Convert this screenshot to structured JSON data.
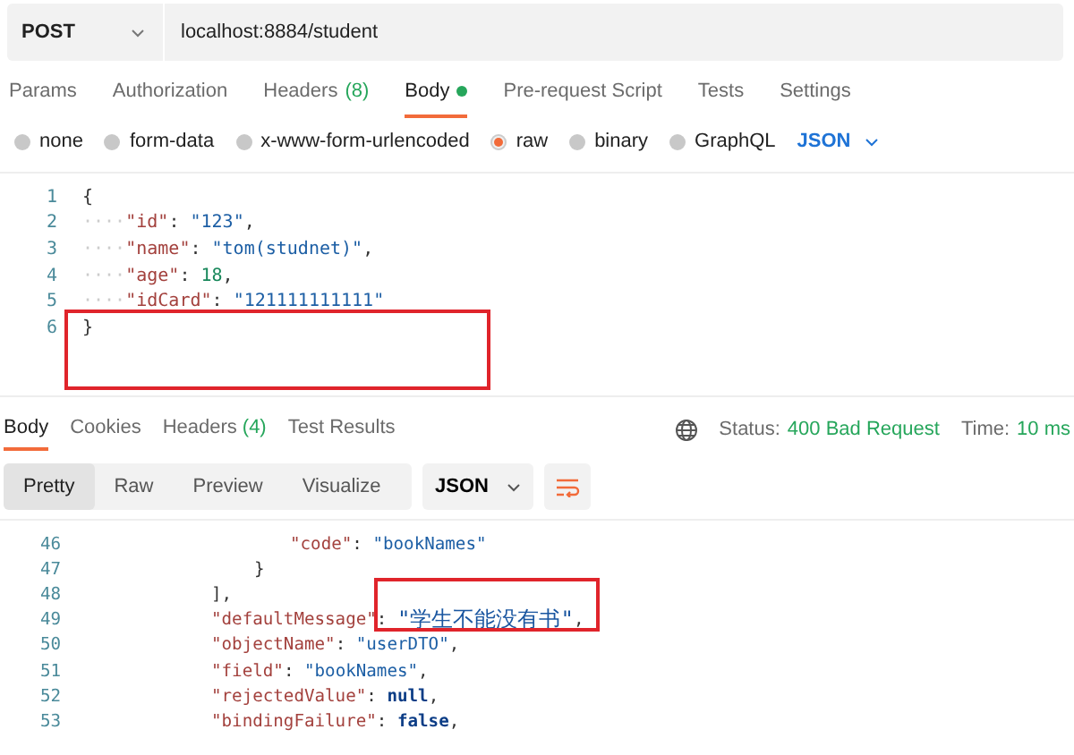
{
  "request": {
    "method": "POST",
    "url": "localhost:8884/student"
  },
  "request_tabs": [
    {
      "label": "Params",
      "selected": false,
      "dot": false
    },
    {
      "label": "Authorization",
      "selected": false,
      "dot": false
    },
    {
      "label": "Headers",
      "count": "(8)",
      "selected": false,
      "dot": false
    },
    {
      "label": "Body",
      "selected": true,
      "dot": true
    },
    {
      "label": "Pre-request Script",
      "selected": false,
      "dot": false
    },
    {
      "label": "Tests",
      "selected": false,
      "dot": false
    },
    {
      "label": "Settings",
      "selected": false,
      "dot": false
    }
  ],
  "body_types": [
    {
      "label": "none",
      "selected": false
    },
    {
      "label": "form-data",
      "selected": false
    },
    {
      "label": "x-www-form-urlencoded",
      "selected": false
    },
    {
      "label": "raw",
      "selected": true
    },
    {
      "label": "binary",
      "selected": false
    },
    {
      "label": "GraphQL",
      "selected": false
    }
  ],
  "body_format": "JSON",
  "request_body": [
    {
      "number": "1",
      "tokens": [
        {
          "kind": "punct",
          "text": "{"
        }
      ]
    },
    {
      "number": "2",
      "tokens": [
        {
          "kind": "ws",
          "text": "····"
        },
        {
          "kind": "key",
          "text": "\"id\""
        },
        {
          "kind": "punct",
          "text": ": "
        },
        {
          "kind": "str",
          "text": "\"123\""
        },
        {
          "kind": "punct",
          "text": ","
        }
      ]
    },
    {
      "number": "3",
      "tokens": [
        {
          "kind": "ws",
          "text": "····"
        },
        {
          "kind": "key",
          "text": "\"name\""
        },
        {
          "kind": "punct",
          "text": ": "
        },
        {
          "kind": "str",
          "text": "\"tom(studnet)\""
        },
        {
          "kind": "punct",
          "text": ","
        }
      ]
    },
    {
      "number": "4",
      "tokens": [
        {
          "kind": "ws",
          "text": "····"
        },
        {
          "kind": "key",
          "text": "\"age\""
        },
        {
          "kind": "punct",
          "text": ": "
        },
        {
          "kind": "num",
          "text": "18"
        },
        {
          "kind": "punct",
          "text": ","
        }
      ]
    },
    {
      "number": "5",
      "tokens": [
        {
          "kind": "ws",
          "text": "····"
        },
        {
          "kind": "key",
          "text": "\"idCard\""
        },
        {
          "kind": "punct",
          "text": ": "
        },
        {
          "kind": "str",
          "text": "\"121111111111\""
        }
      ]
    },
    {
      "number": "6",
      "tokens": [
        {
          "kind": "punct",
          "text": "}"
        }
      ]
    }
  ],
  "response_tabs": [
    {
      "label": "Body",
      "selected": true
    },
    {
      "label": "Cookies",
      "selected": false
    },
    {
      "label": "Headers",
      "count": "(4)",
      "selected": false
    },
    {
      "label": "Test Results",
      "selected": false
    }
  ],
  "status": {
    "label": "Status:",
    "value": "400 Bad Request"
  },
  "time": {
    "label": "Time:",
    "value": "10 ms"
  },
  "view_modes": [
    {
      "label": "Pretty",
      "selected": true
    },
    {
      "label": "Raw",
      "selected": false
    },
    {
      "label": "Preview",
      "selected": false
    },
    {
      "label": "Visualize",
      "selected": false
    }
  ],
  "response_format": "JSON",
  "response_body": [
    {
      "number": "46",
      "kind": "deep",
      "tokens": [
        {
          "kind": "key",
          "text": "\"code\""
        },
        {
          "kind": "punct",
          "text": ": "
        },
        {
          "kind": "str",
          "text": "\"bookNames\""
        }
      ]
    },
    {
      "number": "47",
      "kind": "inner",
      "tokens": [
        {
          "kind": "punct",
          "text": "}"
        }
      ]
    },
    {
      "number": "48",
      "kind": "outer",
      "tokens": [
        {
          "kind": "punct",
          "text": "],"
        }
      ]
    },
    {
      "number": "49",
      "kind": "outer",
      "tokens": [
        {
          "kind": "key",
          "text": "\"defaultMessage\""
        },
        {
          "kind": "punct",
          "text": ": "
        },
        {
          "kind": "str",
          "text": "\"学生不能没有书\""
        },
        {
          "kind": "punct",
          "text": ","
        }
      ]
    },
    {
      "number": "50",
      "kind": "outer",
      "tokens": [
        {
          "kind": "key",
          "text": "\"objectName\""
        },
        {
          "kind": "punct",
          "text": ": "
        },
        {
          "kind": "str",
          "text": "\"userDTO\""
        },
        {
          "kind": "punct",
          "text": ","
        }
      ]
    },
    {
      "number": "51",
      "kind": "outer",
      "tokens": [
        {
          "kind": "key",
          "text": "\"field\""
        },
        {
          "kind": "punct",
          "text": ": "
        },
        {
          "kind": "str",
          "text": "\"bookNames\""
        },
        {
          "kind": "punct",
          "text": ","
        }
      ]
    },
    {
      "number": "52",
      "kind": "outer",
      "tokens": [
        {
          "kind": "key",
          "text": "\"rejectedValue\""
        },
        {
          "kind": "punct",
          "text": ": "
        },
        {
          "kind": "kw",
          "text": "null"
        },
        {
          "kind": "punct",
          "text": ","
        }
      ]
    },
    {
      "number": "53",
      "kind": "outer",
      "tokens": [
        {
          "kind": "key",
          "text": "\"bindingFailure\""
        },
        {
          "kind": "punct",
          "text": ": "
        },
        {
          "kind": "kw",
          "text": "false"
        },
        {
          "kind": "punct",
          "text": ","
        }
      ]
    }
  ]
}
